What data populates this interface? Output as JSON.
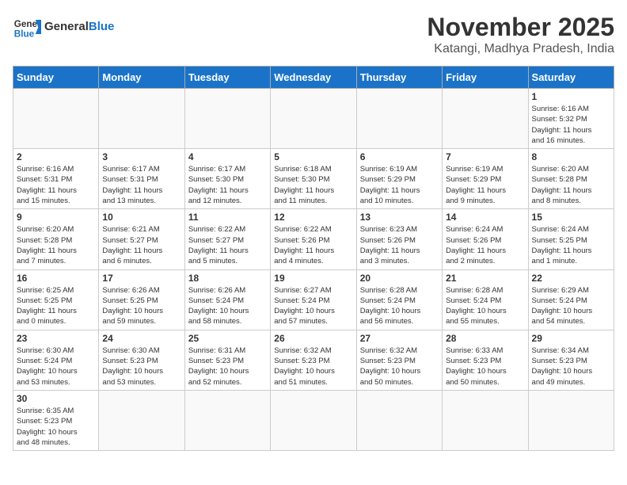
{
  "header": {
    "logo_general": "General",
    "logo_blue": "Blue",
    "title": "November 2025",
    "subtitle": "Katangi, Madhya Pradesh, India"
  },
  "weekdays": [
    "Sunday",
    "Monday",
    "Tuesday",
    "Wednesday",
    "Thursday",
    "Friday",
    "Saturday"
  ],
  "weeks": [
    [
      {
        "day": "",
        "info": ""
      },
      {
        "day": "",
        "info": ""
      },
      {
        "day": "",
        "info": ""
      },
      {
        "day": "",
        "info": ""
      },
      {
        "day": "",
        "info": ""
      },
      {
        "day": "",
        "info": ""
      },
      {
        "day": "1",
        "info": "Sunrise: 6:16 AM\nSunset: 5:32 PM\nDaylight: 11 hours\nand 16 minutes."
      }
    ],
    [
      {
        "day": "2",
        "info": "Sunrise: 6:16 AM\nSunset: 5:31 PM\nDaylight: 11 hours\nand 15 minutes."
      },
      {
        "day": "3",
        "info": "Sunrise: 6:17 AM\nSunset: 5:31 PM\nDaylight: 11 hours\nand 13 minutes."
      },
      {
        "day": "4",
        "info": "Sunrise: 6:17 AM\nSunset: 5:30 PM\nDaylight: 11 hours\nand 12 minutes."
      },
      {
        "day": "5",
        "info": "Sunrise: 6:18 AM\nSunset: 5:30 PM\nDaylight: 11 hours\nand 11 minutes."
      },
      {
        "day": "6",
        "info": "Sunrise: 6:19 AM\nSunset: 5:29 PM\nDaylight: 11 hours\nand 10 minutes."
      },
      {
        "day": "7",
        "info": "Sunrise: 6:19 AM\nSunset: 5:29 PM\nDaylight: 11 hours\nand 9 minutes."
      },
      {
        "day": "8",
        "info": "Sunrise: 6:20 AM\nSunset: 5:28 PM\nDaylight: 11 hours\nand 8 minutes."
      }
    ],
    [
      {
        "day": "9",
        "info": "Sunrise: 6:20 AM\nSunset: 5:28 PM\nDaylight: 11 hours\nand 7 minutes."
      },
      {
        "day": "10",
        "info": "Sunrise: 6:21 AM\nSunset: 5:27 PM\nDaylight: 11 hours\nand 6 minutes."
      },
      {
        "day": "11",
        "info": "Sunrise: 6:22 AM\nSunset: 5:27 PM\nDaylight: 11 hours\nand 5 minutes."
      },
      {
        "day": "12",
        "info": "Sunrise: 6:22 AM\nSunset: 5:26 PM\nDaylight: 11 hours\nand 4 minutes."
      },
      {
        "day": "13",
        "info": "Sunrise: 6:23 AM\nSunset: 5:26 PM\nDaylight: 11 hours\nand 3 minutes."
      },
      {
        "day": "14",
        "info": "Sunrise: 6:24 AM\nSunset: 5:26 PM\nDaylight: 11 hours\nand 2 minutes."
      },
      {
        "day": "15",
        "info": "Sunrise: 6:24 AM\nSunset: 5:25 PM\nDaylight: 11 hours\nand 1 minute."
      }
    ],
    [
      {
        "day": "16",
        "info": "Sunrise: 6:25 AM\nSunset: 5:25 PM\nDaylight: 11 hours\nand 0 minutes."
      },
      {
        "day": "17",
        "info": "Sunrise: 6:26 AM\nSunset: 5:25 PM\nDaylight: 10 hours\nand 59 minutes."
      },
      {
        "day": "18",
        "info": "Sunrise: 6:26 AM\nSunset: 5:24 PM\nDaylight: 10 hours\nand 58 minutes."
      },
      {
        "day": "19",
        "info": "Sunrise: 6:27 AM\nSunset: 5:24 PM\nDaylight: 10 hours\nand 57 minutes."
      },
      {
        "day": "20",
        "info": "Sunrise: 6:28 AM\nSunset: 5:24 PM\nDaylight: 10 hours\nand 56 minutes."
      },
      {
        "day": "21",
        "info": "Sunrise: 6:28 AM\nSunset: 5:24 PM\nDaylight: 10 hours\nand 55 minutes."
      },
      {
        "day": "22",
        "info": "Sunrise: 6:29 AM\nSunset: 5:24 PM\nDaylight: 10 hours\nand 54 minutes."
      }
    ],
    [
      {
        "day": "23",
        "info": "Sunrise: 6:30 AM\nSunset: 5:24 PM\nDaylight: 10 hours\nand 53 minutes."
      },
      {
        "day": "24",
        "info": "Sunrise: 6:30 AM\nSunset: 5:23 PM\nDaylight: 10 hours\nand 53 minutes."
      },
      {
        "day": "25",
        "info": "Sunrise: 6:31 AM\nSunset: 5:23 PM\nDaylight: 10 hours\nand 52 minutes."
      },
      {
        "day": "26",
        "info": "Sunrise: 6:32 AM\nSunset: 5:23 PM\nDaylight: 10 hours\nand 51 minutes."
      },
      {
        "day": "27",
        "info": "Sunrise: 6:32 AM\nSunset: 5:23 PM\nDaylight: 10 hours\nand 50 minutes."
      },
      {
        "day": "28",
        "info": "Sunrise: 6:33 AM\nSunset: 5:23 PM\nDaylight: 10 hours\nand 50 minutes."
      },
      {
        "day": "29",
        "info": "Sunrise: 6:34 AM\nSunset: 5:23 PM\nDaylight: 10 hours\nand 49 minutes."
      }
    ],
    [
      {
        "day": "30",
        "info": "Sunrise: 6:35 AM\nSunset: 5:23 PM\nDaylight: 10 hours\nand 48 minutes."
      },
      {
        "day": "",
        "info": ""
      },
      {
        "day": "",
        "info": ""
      },
      {
        "day": "",
        "info": ""
      },
      {
        "day": "",
        "info": ""
      },
      {
        "day": "",
        "info": ""
      },
      {
        "day": "",
        "info": ""
      }
    ]
  ]
}
